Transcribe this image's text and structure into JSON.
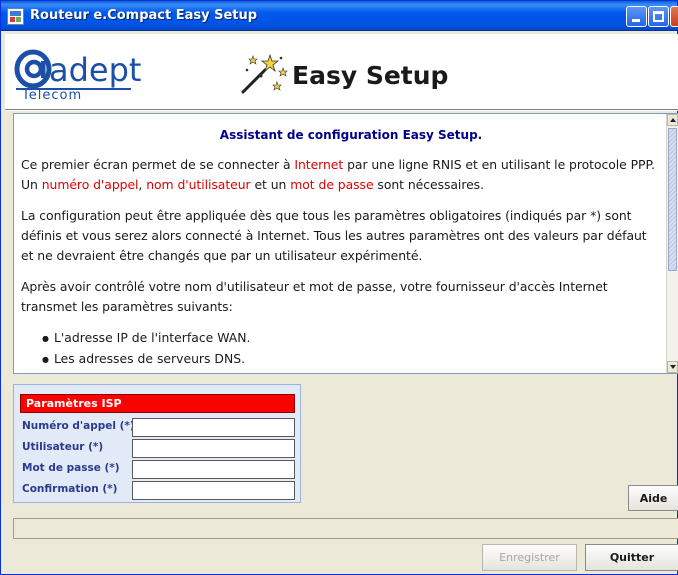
{
  "window": {
    "title": "Routeur e.Compact Easy Setup"
  },
  "banner": {
    "logo_main": "adept",
    "logo_sub": "Telecom",
    "title": "Easy Setup"
  },
  "info": {
    "heading": "Assistant de configuration Easy Setup.",
    "para1": {
      "t1": "Ce premier écran permet de se connecter à ",
      "h1": "Internet",
      "t2": " par une ligne RNIS et en utilisant le protocole PPP. Un ",
      "h2": "numéro d'appel",
      "t3": ", ",
      "h3": "nom d'utilisateur",
      "t4": " et un ",
      "h4": "mot de passe",
      "t5": " sont nécessaires."
    },
    "para2": "La configuration peut être appliquée dès que tous les paramètres obligatoires (indiqués par *) sont définis et vous serez alors connecté à Internet. Tous les autres paramètres ont des valeurs par défaut et ne devraient être changés que par un utilisateur expérimenté.",
    "para3": "Après avoir contrôlé votre nom d'utilisateur et mot de passe, votre fournisseur d'accès Internet transmet les paramètres suivants:",
    "list": [
      "L'adresse IP de l'interface WAN.",
      "Les adresses de serveurs DNS."
    ]
  },
  "isp": {
    "header": "Paramètres ISP",
    "fields": [
      {
        "label": "Numéro d'appel (*)",
        "value": ""
      },
      {
        "label": "Utilisateur (*)",
        "value": ""
      },
      {
        "label": "Mot de passe (*)",
        "value": ""
      },
      {
        "label": "Confirmation (*)",
        "value": ""
      }
    ]
  },
  "buttons": {
    "help": "Aide",
    "save": "Enregistrer",
    "quit": "Quitter"
  },
  "status": {
    "text": ""
  },
  "colors": {
    "title_bar": "#0054e3",
    "highlight": "#e00000",
    "heading": "#00008b",
    "isp_header_bg": "#ff0000",
    "isp_label": "#2a3a8c"
  }
}
